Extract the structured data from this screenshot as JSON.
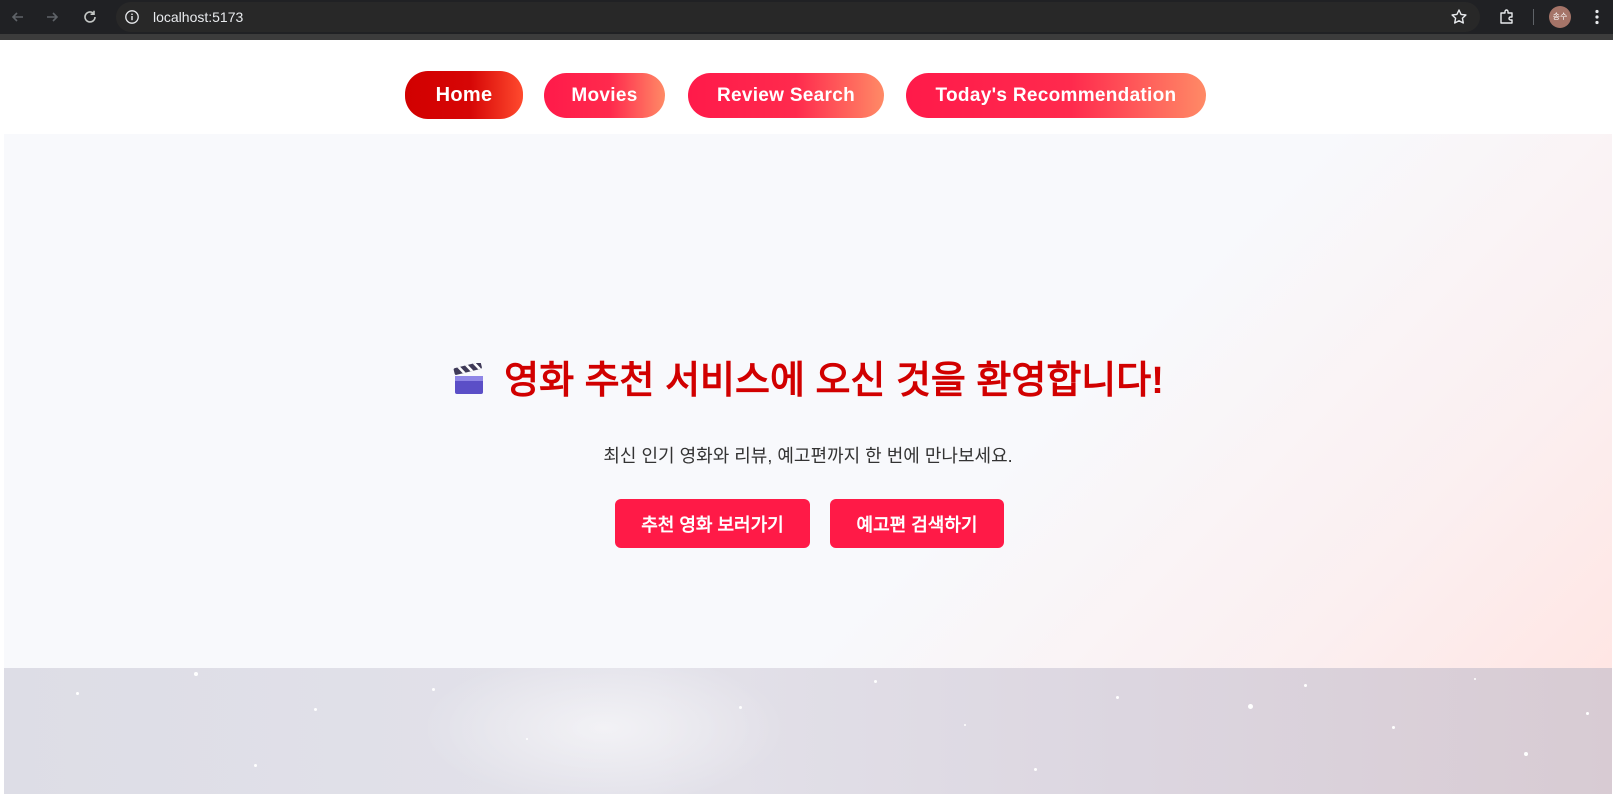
{
  "browser": {
    "url": "localhost:5173",
    "profile_initials": "송수",
    "icons": {
      "back": "arrow-left-icon",
      "forward": "arrow-right-icon",
      "reload": "reload-icon",
      "site_info": "info-icon",
      "bookmark": "star-icon",
      "extensions": "puzzle-icon",
      "menu": "kebab-menu-icon"
    }
  },
  "nav": {
    "items": [
      {
        "label": "Home",
        "active": true
      },
      {
        "label": "Movies",
        "active": false
      },
      {
        "label": "Review Search",
        "active": false
      },
      {
        "label": "Today's Recommendation",
        "active": false
      }
    ]
  },
  "hero": {
    "icon": "clapperboard-icon",
    "title": "영화 추천 서비스에 오신 것을 환영합니다!",
    "subtitle": "최신 인기 영화와 리뷰, 예고편까지 한 번에 만나보세요.",
    "buttons": [
      {
        "label": "추천 영화 보러가기"
      },
      {
        "label": "예고편 검색하기"
      }
    ]
  },
  "colors": {
    "accent": "#ff1a47",
    "title": "#d10000",
    "active_nav": "#d20000"
  }
}
